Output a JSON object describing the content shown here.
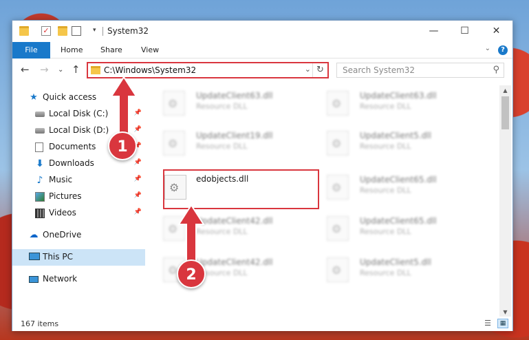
{
  "window": {
    "title": "System32",
    "controls": {
      "minimize": "—",
      "maximize": "☐",
      "close": "✕"
    }
  },
  "ribbon": {
    "file_label": "File",
    "tabs": [
      "Home",
      "Share",
      "View"
    ]
  },
  "address": {
    "path": "C:\\Windows\\System32",
    "refresh_glyph": "↻"
  },
  "search": {
    "placeholder": "Search System32"
  },
  "sidebar": {
    "items": [
      {
        "label": "Quick access",
        "icon": "star-icon",
        "pinned": false
      },
      {
        "label": "Local Disk (C:)",
        "icon": "disk-icon",
        "pinned": true
      },
      {
        "label": "Local Disk (D:)",
        "icon": "disk-icon",
        "pinned": true
      },
      {
        "label": "Documents",
        "icon": "documents-icon",
        "pinned": true
      },
      {
        "label": "Downloads",
        "icon": "downloads-icon",
        "pinned": true
      },
      {
        "label": "Music",
        "icon": "music-icon",
        "pinned": true
      },
      {
        "label": "Pictures",
        "icon": "pictures-icon",
        "pinned": true
      },
      {
        "label": "Videos",
        "icon": "videos-icon",
        "pinned": true
      },
      {
        "label": "OneDrive",
        "icon": "onedrive-icon",
        "pinned": false
      },
      {
        "label": "This PC",
        "icon": "computer-icon",
        "pinned": false,
        "selected": true
      },
      {
        "label": "Network",
        "icon": "network-icon",
        "pinned": false
      }
    ]
  },
  "files": [
    {
      "name": "UpdateClient63.dll",
      "type": "Resource DLL",
      "blurred": true
    },
    {
      "name": "UpdateClient63.dll",
      "type": "Resource DLL",
      "blurred": true
    },
    {
      "name": "UpdateClient19.dll",
      "type": "Resource DLL",
      "blurred": true
    },
    {
      "name": "UpdateClient5.dll",
      "type": "Resource DLL",
      "blurred": true
    },
    {
      "name": "edobjects.dll",
      "type": "",
      "blurred": false
    },
    {
      "name": "UpdateClient65.dll",
      "type": "Resource DLL",
      "blurred": true
    },
    {
      "name": "UpdateClient42.dll",
      "type": "Resource DLL",
      "blurred": true
    },
    {
      "name": "UpdateClient65.dll",
      "type": "Resource DLL",
      "blurred": true
    },
    {
      "name": "UpdateClient42.dll",
      "type": "Resource DLL",
      "blurred": true
    },
    {
      "name": "UpdateClient5.dll",
      "type": "Resource DLL",
      "blurred": true
    }
  ],
  "status": {
    "item_count": "167 items"
  },
  "callouts": {
    "first": "1",
    "second": "2"
  },
  "colors": {
    "accent": "#1979ca",
    "highlight": "#d9363e",
    "selected_bg": "#cce4f7"
  }
}
